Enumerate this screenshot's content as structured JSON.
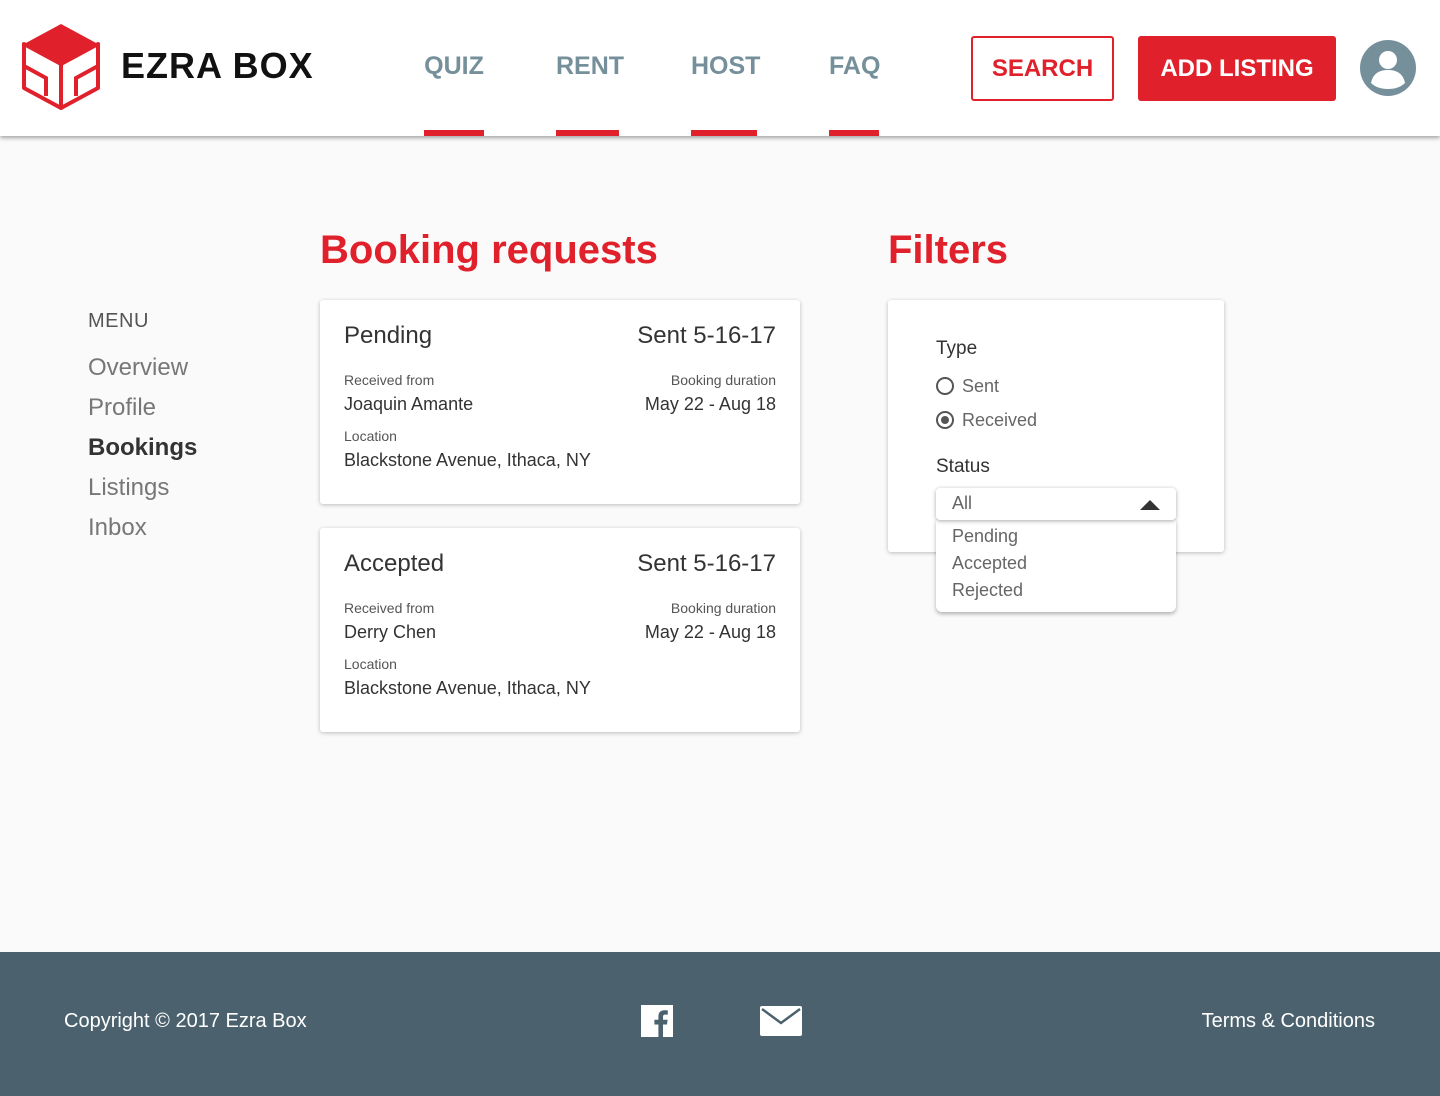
{
  "brand": {
    "name": "EZRA BOX",
    "logo_icon": "box-logo-icon",
    "accent": "#e0202a"
  },
  "nav": {
    "items": [
      {
        "label": "QUIZ"
      },
      {
        "label": "RENT"
      },
      {
        "label": "HOST"
      },
      {
        "label": "FAQ"
      }
    ]
  },
  "header": {
    "search_label": "SEARCH",
    "add_listing_label": "ADD LISTING",
    "avatar_icon": "user-avatar-icon"
  },
  "menu": {
    "title": "MENU",
    "items": [
      {
        "label": "Overview",
        "active": false
      },
      {
        "label": "Profile",
        "active": false
      },
      {
        "label": "Bookings",
        "active": true
      },
      {
        "label": "Listings",
        "active": false
      },
      {
        "label": "Inbox",
        "active": false
      }
    ]
  },
  "bookings": {
    "title": "Booking requests",
    "cards": [
      {
        "status": "Pending",
        "sent": "Sent 5-16-17",
        "received_from_label": "Received from",
        "received_from": "Joaquin Amante",
        "duration_label": "Booking duration",
        "duration": "May 22 - Aug 18",
        "location_label": "Location",
        "location": "Blackstone Avenue, Ithaca, NY"
      },
      {
        "status": "Accepted",
        "sent": "Sent 5-16-17",
        "received_from_label": "Received from",
        "received_from": "Derry Chen",
        "duration_label": "Booking duration",
        "duration": "May 22 - Aug 18",
        "location_label": "Location",
        "location": "Blackstone Avenue, Ithaca, NY"
      }
    ]
  },
  "filters": {
    "title": "Filters",
    "type_label": "Type",
    "type_options": [
      {
        "label": "Sent",
        "checked": false
      },
      {
        "label": "Received",
        "checked": true
      }
    ],
    "status_label": "Status",
    "status_selected": "All",
    "status_options": [
      "Pending",
      "Accepted",
      "Rejected"
    ]
  },
  "footer": {
    "copyright": "Copyright © 2017 Ezra Box",
    "facebook_icon": "facebook-icon",
    "mail_icon": "mail-icon",
    "terms": "Terms & Conditions",
    "bg": "#4b626e"
  }
}
